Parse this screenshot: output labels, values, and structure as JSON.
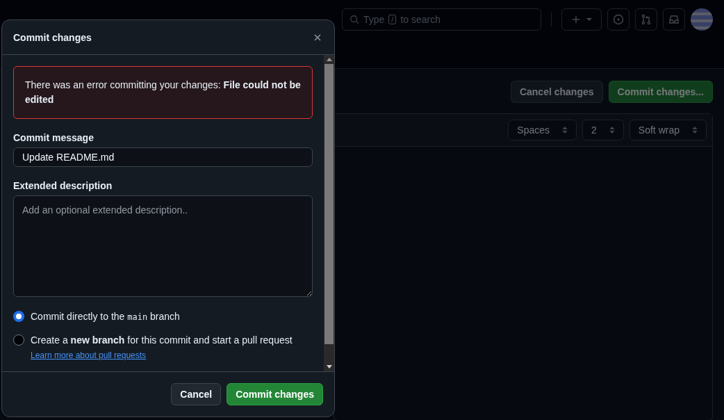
{
  "header": {
    "search": {
      "before": "Type",
      "key": "/",
      "after": "to search"
    }
  },
  "page_actions": [
    {
      "label": "Cancel changes",
      "kind": "default"
    },
    {
      "label": "Commit changes...",
      "kind": "primary"
    }
  ],
  "editor_toolbar": {
    "selects": [
      "Spaces",
      "2",
      "Soft wrap"
    ]
  },
  "dialog": {
    "title": "Commit changes",
    "error": "There was an error committing your changes: **File could not be edited**",
    "message_label": "Commit message",
    "message_value": "Update README.md",
    "description_label": "Extended description",
    "description_placeholder": "Add an optional extended description..",
    "options": [
      {
        "selected": true,
        "parts": [
          {
            "kind": "text",
            "text": "Commit directly to the"
          },
          {
            "kind": "code",
            "text": "main"
          },
          {
            "kind": "text",
            "text": "branch"
          }
        ]
      },
      {
        "selected": false,
        "parts": [
          {
            "kind": "text",
            "text": "Create a **new branch** for this commit and start a pull request"
          },
          {
            "kind": "link",
            "text": "Learn more about pull requests"
          }
        ]
      }
    ],
    "buttons": [
      {
        "label": "Cancel",
        "kind": "default"
      },
      {
        "label": "Commit changes",
        "kind": "primary"
      }
    ]
  }
}
